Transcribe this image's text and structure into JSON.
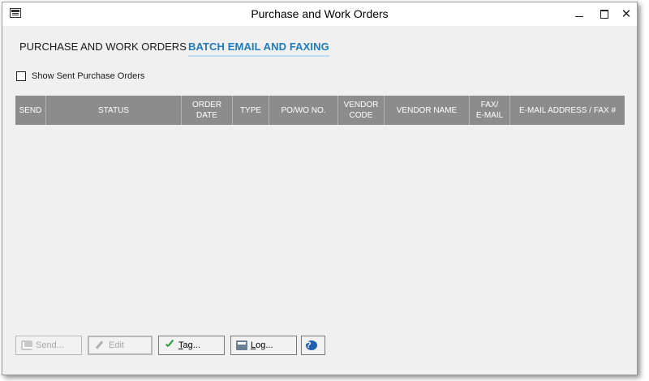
{
  "window": {
    "title": "Purchase and Work Orders",
    "controls": {
      "minimize": "—",
      "maximize": "□",
      "close": "✕"
    }
  },
  "tabs": [
    {
      "label": "PURCHASE AND WORK ORDERS",
      "active": false
    },
    {
      "label": "BATCH EMAIL AND FAXING",
      "active": true
    }
  ],
  "filter": {
    "show_sent_label": "Show Sent Purchase Orders",
    "checked": false
  },
  "grid": {
    "columns": [
      {
        "lines": [
          "SEND"
        ]
      },
      {
        "lines": [
          "STATUS"
        ]
      },
      {
        "lines": [
          "ORDER",
          "DATE"
        ]
      },
      {
        "lines": [
          "TYPE"
        ]
      },
      {
        "lines": [
          "PO/WO NO."
        ]
      },
      {
        "lines": [
          "VENDOR",
          "CODE"
        ]
      },
      {
        "lines": [
          "VENDOR NAME"
        ]
      },
      {
        "lines": [
          "FAX/",
          "E-MAIL"
        ]
      },
      {
        "lines": [
          "E-MAIL ADDRESS / FAX #"
        ]
      }
    ],
    "rows": []
  },
  "buttons": {
    "send": {
      "label": "Send...",
      "icon": "envelope-icon",
      "enabled": false
    },
    "edit": {
      "label": "Edit",
      "icon": "pencil-icon",
      "enabled": false
    },
    "tag": {
      "hotkey": "T",
      "rest": "ag...",
      "icon": "checkmark-icon",
      "enabled": true
    },
    "log": {
      "hotkey": "L",
      "rest": "og...",
      "icon": "printer-icon",
      "enabled": true
    },
    "help": {
      "label": "?",
      "icon": "help-icon",
      "enabled": true
    }
  },
  "colors": {
    "active_tab": "#1d7bc0",
    "header_bg": "#8c8c8c",
    "client_bg": "#f0f0f0",
    "help_icon": "#1f5fb0"
  }
}
